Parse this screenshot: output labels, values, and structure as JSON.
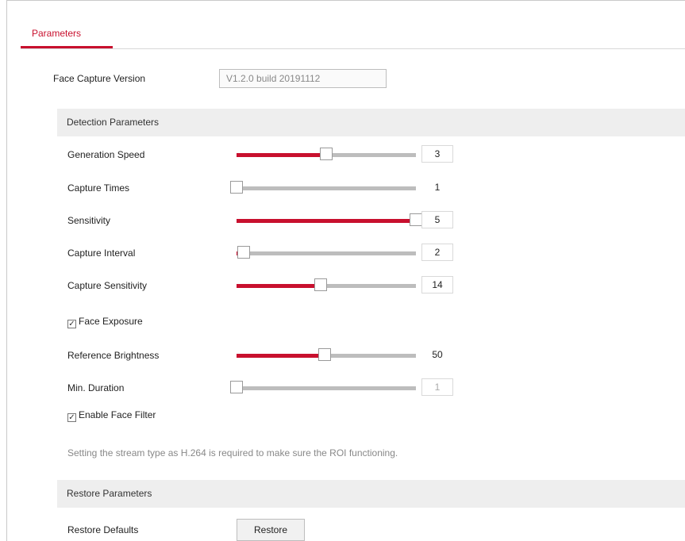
{
  "tabs": [
    {
      "label": "Parameters"
    }
  ],
  "version": {
    "label": "Face Capture Version",
    "value": "V1.2.0 build 20191112"
  },
  "detection_section": {
    "title": "Detection Parameters"
  },
  "sliders": [
    {
      "label": "Generation Speed",
      "value": "3",
      "level": 0.5,
      "boxed": true
    },
    {
      "label": "Capture Times",
      "value": "1",
      "level": 0.0,
      "boxed": false
    },
    {
      "label": "Sensitivity",
      "value": "5",
      "level": 1.0,
      "boxed": true
    },
    {
      "label": "Capture Interval",
      "value": "2",
      "level": 0.04,
      "boxed": true
    },
    {
      "label": "Capture Sensitivity",
      "value": "14",
      "level": 0.47,
      "boxed": true
    }
  ],
  "face_exposure": {
    "label": "Face Exposure",
    "checked": true
  },
  "exposure_sliders": [
    {
      "label": "Reference Brightness",
      "value": "50",
      "level": 0.49,
      "boxed": false,
      "dim": false
    },
    {
      "label": "Min. Duration",
      "value": "1",
      "level": 0.0,
      "boxed": true,
      "dim": true
    }
  ],
  "face_filter": {
    "label": "Enable Face Filter",
    "checked": true
  },
  "note": "Setting the stream type as H.264 is required to make sure the ROI functioning.",
  "restore_section": {
    "title": "Restore Parameters"
  },
  "restore": {
    "label": "Restore Defaults",
    "button": "Restore"
  },
  "colors": {
    "accent": "#c8102e",
    "track": "#bdbdbd",
    "section_bg": "#eeeeee"
  }
}
